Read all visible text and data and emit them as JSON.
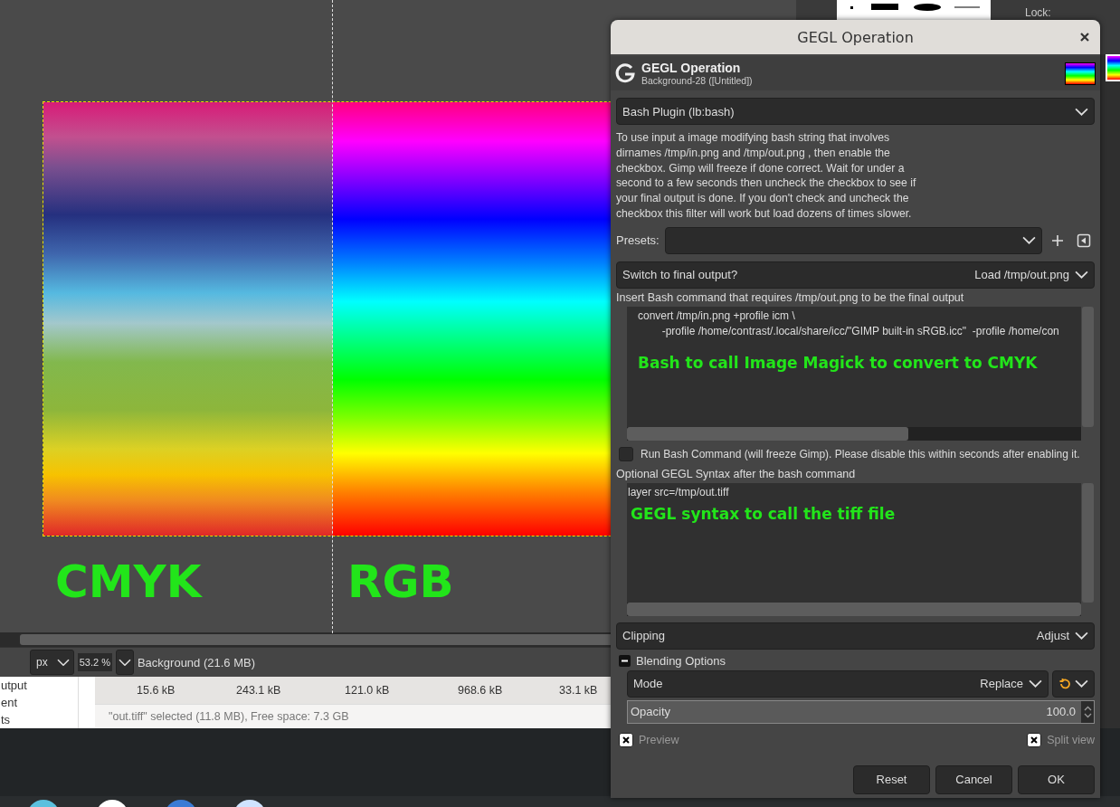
{
  "canvas": {
    "labels": [
      "CMYK",
      "RGB"
    ]
  },
  "status_bar": {
    "unit": "px",
    "zoom": "53.2 %",
    "layer": "Background (21.6 MB)"
  },
  "file_manager": {
    "sidebar_items": [
      "utput",
      "ent",
      "ts"
    ],
    "sizes": [
      "15.6 kB",
      "243.1 kB",
      "121.0 kB",
      "968.6 kB",
      "33.1 kB"
    ],
    "status": "\"out.tiff\" selected (11.8 MB), Free space: 7.3 GB"
  },
  "dock": {
    "lock_label": "Lock:"
  },
  "dialog": {
    "title": "GEGL Operation",
    "header_title": "GEGL Operation",
    "header_subtitle": "Background-28 ([Untitled])",
    "operation": "Bash Plugin (lb:bash)",
    "description": "To use input a image modifying bash string that involves\ndirnames /tmp/in.png and /tmp/out.png , then enable the\ncheckbox. Gimp will freeze if done correct. Wait for under a\nsecond to a few seconds  then uncheck the checkbox to see if\nyour final output is done. If you don't check and uncheck the\ncheckbox this filter will work but load dozens of times slower.",
    "presets_label": "Presets:",
    "switch": {
      "label": "Switch to final output?",
      "value": "Load /tmp/out.png"
    },
    "bash_label": "Insert Bash command that requires /tmp/out.png to be the final output",
    "bash_lines": [
      "convert /tmp/in.png +profile icm \\",
      "        -profile /home/contrast/.local/share/icc/\"GIMP built-in sRGB.icc\"  -profile /home/con"
    ],
    "bash_annotation": "Bash to call Image Magick to convert to CMYK",
    "run_checkbox": {
      "label": "Run Bash Command (will freeze Gimp). Please disable this within seconds after enabling it.",
      "checked": false
    },
    "gegl_label": "Optional GEGL Syntax after the bash command",
    "gegl_text": "layer src=/tmp/out.tiff",
    "gegl_annotation": "GEGL syntax to call the tiff file",
    "clipping": {
      "label": "Clipping",
      "value": "Adjust"
    },
    "blending": {
      "label": "Blending Options",
      "expanded": true
    },
    "mode": {
      "label": "Mode",
      "value": "Replace"
    },
    "opacity": {
      "label": "Opacity",
      "value": "100.0",
      "level": 1
    },
    "preview": {
      "label": "Preview",
      "checked": true
    },
    "split_view": {
      "label": "Split view",
      "checked": true
    },
    "buttons": [
      "Reset",
      "Cancel",
      "OK"
    ]
  }
}
